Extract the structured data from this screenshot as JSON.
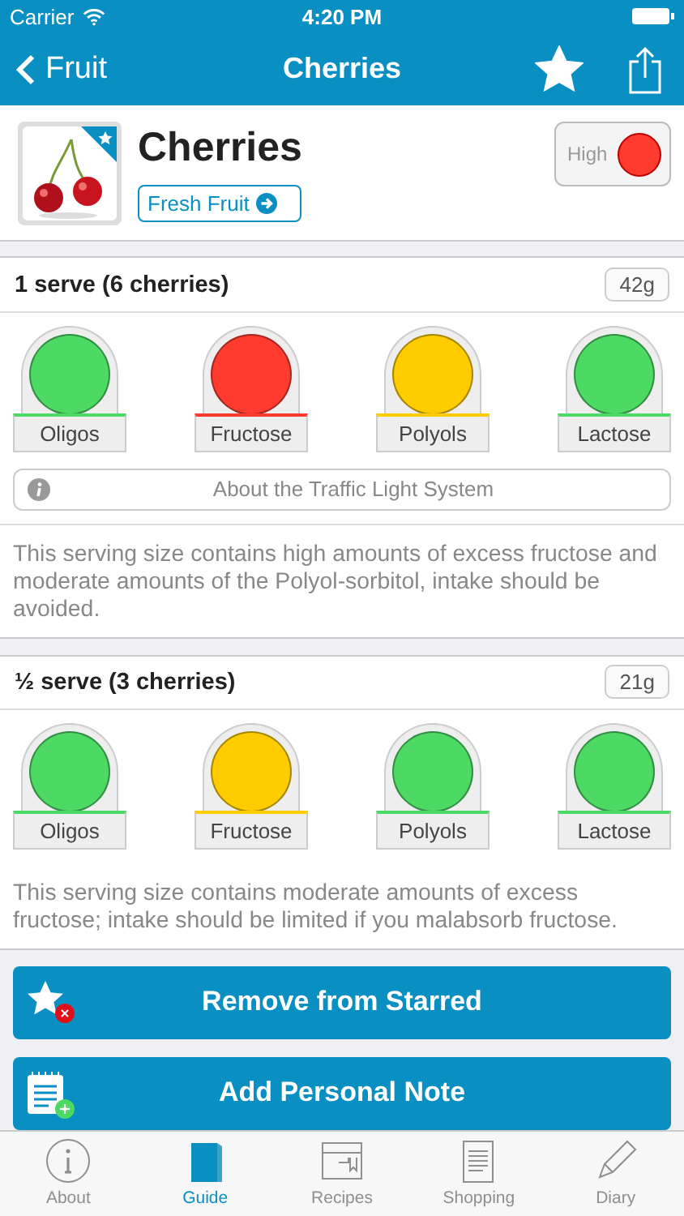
{
  "status_bar": {
    "carrier": "Carrier",
    "time": "4:20 PM"
  },
  "nav": {
    "back": "Fruit",
    "title": "Cherries",
    "starred": true
  },
  "food": {
    "name": "Cherries",
    "category": "Fresh Fruit",
    "overall": {
      "label": "High",
      "color": "#ff3b30"
    },
    "starred": true
  },
  "servings": [
    {
      "title": "1 serve (6 cherries)",
      "weight": "42g",
      "lights": [
        {
          "label": "Oligos",
          "color": "#4cd964"
        },
        {
          "label": "Fructose",
          "color": "#ff3b30"
        },
        {
          "label": "Polyols",
          "color": "#ffcc00"
        },
        {
          "label": "Lactose",
          "color": "#4cd964"
        }
      ],
      "info_button": "About the Traffic Light System",
      "note": "This serving size contains high amounts of excess fructose and moderate amounts of the Polyol-sorbitol, intake should be avoided."
    },
    {
      "title": "½ serve (3 cherries)",
      "weight": "21g",
      "lights": [
        {
          "label": "Oligos",
          "color": "#4cd964"
        },
        {
          "label": "Fructose",
          "color": "#ffcc00"
        },
        {
          "label": "Polyols",
          "color": "#4cd964"
        },
        {
          "label": "Lactose",
          "color": "#4cd964"
        }
      ],
      "note": "This serving size contains moderate amounts of excess fructose; intake should be limited if you malabsorb fructose."
    }
  ],
  "actions": [
    {
      "label": "Remove from Starred",
      "kind": "unstar"
    },
    {
      "label": "Add Personal Note",
      "kind": "note"
    }
  ],
  "tabs": [
    {
      "label": "About",
      "selected": false
    },
    {
      "label": "Guide",
      "selected": true
    },
    {
      "label": "Recipes",
      "selected": false
    },
    {
      "label": "Shopping",
      "selected": false
    },
    {
      "label": "Diary",
      "selected": false
    }
  ]
}
